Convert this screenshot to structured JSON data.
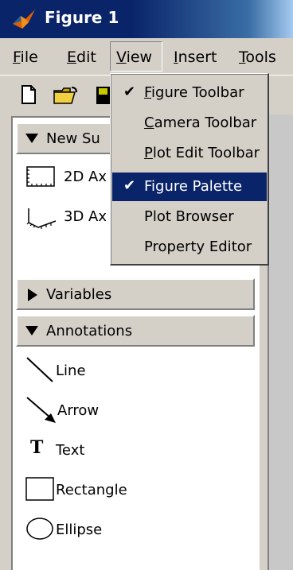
{
  "window": {
    "title": "Figure 1"
  },
  "menubar": {
    "items": [
      {
        "label_u": "F",
        "label_rest": "ile"
      },
      {
        "label_u": "E",
        "label_rest": "dit"
      },
      {
        "label_u": "V",
        "label_rest": "iew"
      },
      {
        "label_u": "I",
        "label_rest": "nsert"
      },
      {
        "label_u": "T",
        "label_rest": "ools"
      }
    ]
  },
  "view_menu": {
    "items": [
      {
        "label_u": "F",
        "label_rest": "igure Toolbar",
        "checked": "✔"
      },
      {
        "label_u": "C",
        "label_rest": "amera Toolbar",
        "checked": ""
      },
      {
        "label_u": "P",
        "label_rest": "lot Edit Toolbar",
        "checked": ""
      },
      {
        "label_u": "",
        "label_rest": "Figure Palette",
        "checked": "✔"
      },
      {
        "label_u": "",
        "label_rest": "Plot Browser",
        "checked": ""
      },
      {
        "label_u": "",
        "label_rest": "Property Editor",
        "checked": ""
      }
    ],
    "selected_index": 3
  },
  "palette": {
    "new_subplots": {
      "label": "New Su",
      "items": [
        "2D Ax",
        "3D Ax"
      ]
    },
    "variables": {
      "label": "Variables"
    },
    "annotations": {
      "label": "Annotations",
      "items": [
        "Line",
        "Arrow",
        "Text",
        "Rectangle",
        "Ellipse"
      ],
      "text_glyph": "T"
    }
  },
  "colors": {
    "title_bar": "#0a246a",
    "menu_highlight": "#0a246a",
    "face": "#d4d0c8"
  }
}
